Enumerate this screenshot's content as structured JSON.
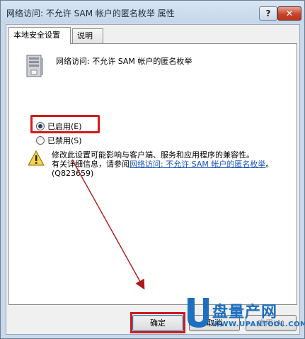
{
  "window": {
    "title": "网络访问: 不允许 SAM 帐户的匿名枚举 属性",
    "help_label": "?",
    "close_label": "✕"
  },
  "tabs": [
    {
      "label": "本地安全设置",
      "active": true
    },
    {
      "label": "说明",
      "active": false
    }
  ],
  "policy": {
    "icon": "server-policy-icon",
    "title": "网络访问: 不允许 SAM 帐户的匿名枚举"
  },
  "options": [
    {
      "label": "已启用(E)",
      "checked": true
    },
    {
      "label": "已禁用(S)",
      "checked": false
    }
  ],
  "warning": {
    "icon": "warning-icon",
    "text_line1": "修改此设置可能影响与客户端、服务和应用程序的兼容性。",
    "text_line2_prefix": "有关详细信息，请参阅",
    "link_text": "网络访问: 不允许 SAM 帐户的匿名枚举",
    "suffix": "。 (Q823659)"
  },
  "buttons": {
    "ok": "确定",
    "cancel": "取消",
    "apply": "应用(A)"
  },
  "watermark": {
    "brand": "盘量产网",
    "url": "WWW.UPANTOOL.COM"
  },
  "colors": {
    "highlight": "#d11a1a",
    "link": "#1a54b6",
    "watermark": "#1d6fc0"
  }
}
